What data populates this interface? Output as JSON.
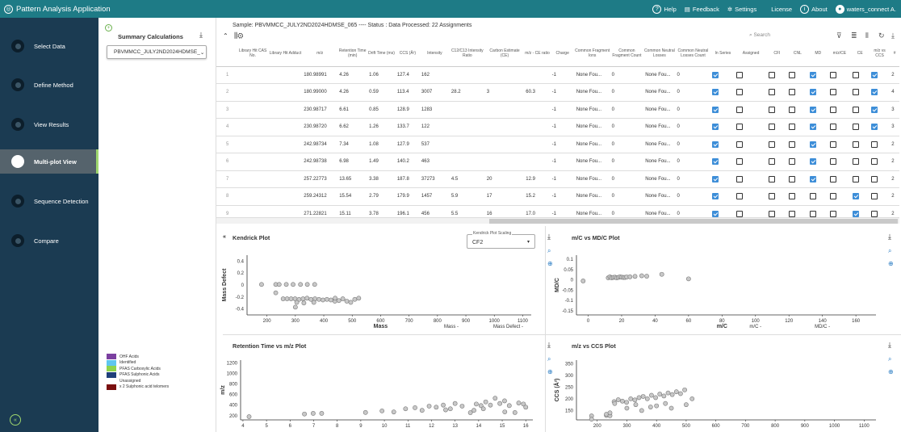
{
  "app": {
    "title": "Pattern Analysis Application"
  },
  "topmenu": {
    "help": "Help",
    "feedback": "Feedback",
    "settings": "Settings",
    "license": "License",
    "about": "About",
    "user": "waters_connect A."
  },
  "steps": [
    "Select Data",
    "Define Method",
    "View Results",
    "Multi-plot View",
    "Sequence Detection",
    "Compare"
  ],
  "summary": {
    "title": "Summary Calculations",
    "selected": "PBVMMCC_JULY2ND2024HDMSE_"
  },
  "legend": [
    {
      "label": "OHF Acids",
      "color": "#7b3fa0"
    },
    {
      "label": "Identified",
      "color": "#5fc6f0"
    },
    {
      "label": "PFAS Carboxylic Acids",
      "color": "#8fd44d"
    },
    {
      "label": "PFAS Sulphonic Acids",
      "color": "#1f3f7a"
    },
    {
      "label": "Unassigned",
      "color": "#ffffff"
    },
    {
      "label": "x 2 Sulphonic acid telomers",
      "color": "#7a1010"
    }
  ],
  "sample_line": "Sample: PBVMMCC_JULY2ND2024HDMSE_065 ---- Status : Data Processed: 22 Assignments",
  "search_placeholder": "Search",
  "columns": [
    "Library Hit CAS No.",
    "Library Hit Adduct",
    "m/z",
    "Retention Time (min)",
    "Drift Time (ms)",
    "CCS (Å²)",
    "Intensity",
    "C12/C13 Intensity Ratio",
    "Carbon Estimate (CE)",
    "m/z - CE ratio",
    "Charge",
    "Common Fragment Ions",
    "Common Fragment Count",
    "Common Neutral Losses",
    "Common Neutral Losses Count",
    "In Series",
    "Assigned",
    "CFI",
    "CNL",
    "MD",
    "m/z/CE",
    "CE",
    "m/z vs CCS",
    "#"
  ],
  "rows": [
    {
      "i": "1",
      "mz": "180.98991",
      "rt": "4.26",
      "dt": "1.06",
      "ccs": "127.4",
      "int": "162",
      "ratio": "",
      "ce": "",
      "mzce": "",
      "chg": "-1",
      "cfi": "None Fou...",
      "cfc": "0",
      "cnl": "None Fou...",
      "cnlc": "0",
      "flags": [
        1,
        0,
        0,
        0,
        1,
        0,
        0,
        1
      ],
      "n": "2"
    },
    {
      "i": "2",
      "mz": "180.99000",
      "rt": "4.26",
      "dt": "0.59",
      "ccs": "113.4",
      "int": "3007",
      "ratio": "28.2",
      "ce": "3",
      "mzce": "60.3",
      "chg": "-1",
      "cfi": "None Fou...",
      "cfc": "0",
      "cnl": "None Fou...",
      "cnlc": "0",
      "flags": [
        1,
        0,
        0,
        0,
        1,
        0,
        0,
        1
      ],
      "n": "4"
    },
    {
      "i": "3",
      "mz": "230.98717",
      "rt": "6.61",
      "dt": "0.85",
      "ccs": "128.9",
      "int": "1283",
      "ratio": "",
      "ce": "",
      "mzce": "",
      "chg": "-1",
      "cfi": "None Fou...",
      "cfc": "0",
      "cnl": "None Fou...",
      "cnlc": "0",
      "flags": [
        1,
        0,
        0,
        0,
        1,
        0,
        0,
        1
      ],
      "n": "3"
    },
    {
      "i": "4",
      "mz": "230.98720",
      "rt": "6.62",
      "dt": "1.26",
      "ccs": "133.7",
      "int": "122",
      "ratio": "",
      "ce": "",
      "mzce": "",
      "chg": "-1",
      "cfi": "None Fou...",
      "cfc": "0",
      "cnl": "None Fou...",
      "cnlc": "0",
      "flags": [
        1,
        0,
        0,
        0,
        1,
        0,
        0,
        1
      ],
      "n": "3"
    },
    {
      "i": "5",
      "mz": "242.98734",
      "rt": "7.34",
      "dt": "1.08",
      "ccs": "127.9",
      "int": "537",
      "ratio": "",
      "ce": "",
      "mzce": "",
      "chg": "-1",
      "cfi": "None Fou...",
      "cfc": "0",
      "cnl": "None Fou...",
      "cnlc": "0",
      "flags": [
        1,
        0,
        0,
        0,
        1,
        0,
        0,
        0
      ],
      "n": "2"
    },
    {
      "i": "6",
      "mz": "242.98738",
      "rt": "6.98",
      "dt": "1.49",
      "ccs": "140.2",
      "int": "463",
      "ratio": "",
      "ce": "",
      "mzce": "",
      "chg": "-1",
      "cfi": "None Fou...",
      "cfc": "0",
      "cnl": "None Fou...",
      "cnlc": "0",
      "flags": [
        1,
        0,
        0,
        0,
        1,
        0,
        0,
        0
      ],
      "n": "2"
    },
    {
      "i": "7",
      "mz": "257.22773",
      "rt": "13.65",
      "dt": "3.38",
      "ccs": "187.8",
      "int": "37273",
      "ratio": "4.5",
      "ce": "20",
      "mzce": "12.9",
      "chg": "-1",
      "cfi": "None Fou...",
      "cfc": "0",
      "cnl": "None Fou...",
      "cnlc": "0",
      "flags": [
        1,
        0,
        0,
        0,
        1,
        0,
        0,
        0
      ],
      "n": "2"
    },
    {
      "i": "8",
      "mz": "259.24312",
      "rt": "15.54",
      "dt": "2.79",
      "ccs": "179.9",
      "int": "1457",
      "ratio": "5.9",
      "ce": "17",
      "mzce": "15.2",
      "chg": "-1",
      "cfi": "None Fou...",
      "cfc": "0",
      "cnl": "None Fou...",
      "cnlc": "0",
      "flags": [
        1,
        0,
        0,
        0,
        0,
        0,
        1,
        0
      ],
      "n": "2"
    },
    {
      "i": "9",
      "mz": "271.22821",
      "rt": "15.11",
      "dt": "3.78",
      "ccs": "196.1",
      "int": "456",
      "ratio": "5.5",
      "ce": "16",
      "mzce": "17.0",
      "chg": "-1",
      "cfi": "None Fou...",
      "cfc": "0",
      "cnl": "None Fou...",
      "cnlc": "0",
      "flags": [
        1,
        0,
        0,
        0,
        0,
        0,
        1,
        0
      ],
      "n": "2"
    }
  ],
  "plots": {
    "kendrick": {
      "title": "Kendrick Plot",
      "scale_label": "Kendrick Plot Scaling",
      "scale_value": "CF2",
      "xlabel": "Mass",
      "ylabel": "Mass Defect",
      "xticks": [
        "200",
        "300",
        "400",
        "500",
        "600",
        "700",
        "800",
        "900",
        "1000",
        "1100"
      ],
      "yticks": [
        "0.4",
        "0.2",
        "0",
        "-0.2",
        "-0.4"
      ],
      "legend": [
        "Mass -",
        "Mass Defect -"
      ]
    },
    "mdc": {
      "title": "m/C vs MD/C Plot",
      "xlabel": "m/C",
      "ylabel": "MD/C",
      "xticks": [
        "0",
        "20",
        "40",
        "60",
        "80",
        "100",
        "120",
        "140",
        "160"
      ],
      "yticks": [
        "0.1",
        "0.05",
        "0",
        "-0.05",
        "-0.1",
        "-0.15"
      ],
      "legend": [
        "m/C -",
        "MD/C -"
      ]
    },
    "rt": {
      "title": "Retention Time vs m/z Plot",
      "ylabel": "m/z",
      "xticks": [
        "4",
        "5",
        "6",
        "7",
        "8",
        "9",
        "10",
        "11",
        "12",
        "13",
        "14",
        "15",
        "16"
      ],
      "yticks": [
        "1200",
        "1000",
        "800",
        "600",
        "400",
        "200"
      ]
    },
    "ccs": {
      "title": "m/z vs CCS Plot",
      "ylabel": "CCS (Å²)",
      "xticks": [
        "200",
        "300",
        "400",
        "500",
        "600",
        "700",
        "800",
        "900",
        "1000",
        "1100"
      ],
      "yticks": [
        "350",
        "300",
        "250",
        "200",
        "150"
      ]
    }
  }
}
